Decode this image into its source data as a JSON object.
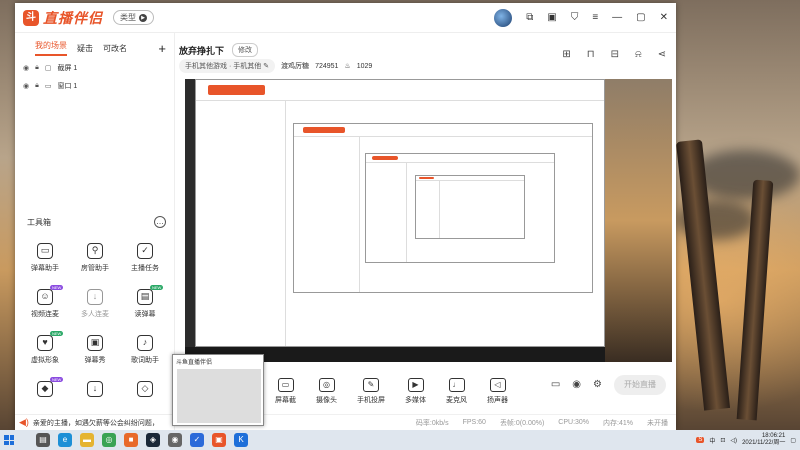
{
  "app": {
    "logo_text": "直播伴侣",
    "type_button": "类型",
    "brand_color": "#e8552a"
  },
  "titlebar_icons": [
    "avatar",
    "share-screen-icon",
    "save-icon",
    "shirt-icon",
    "menu-icon",
    "minimize-icon",
    "maximize-icon",
    "close-icon"
  ],
  "sidebar": {
    "tabs": [
      "我的场景",
      "疑击",
      "可改名"
    ],
    "add_label": "+",
    "sources": [
      {
        "label": "截屏 1"
      },
      {
        "label": "窗口 1"
      }
    ],
    "tools_title": "工具箱",
    "tools_more": "…",
    "tools": [
      {
        "label": "弹幕助手",
        "icon": "▭",
        "badge": ""
      },
      {
        "label": "房管助手",
        "icon": "⚲",
        "badge": ""
      },
      {
        "label": "主播任务",
        "icon": "✓",
        "badge": ""
      },
      {
        "label": "视频连麦",
        "icon": "☺",
        "badge": "NEW"
      },
      {
        "label": "多人连麦",
        "icon": "↓",
        "badge": ""
      },
      {
        "label": "读弹幕",
        "icon": "▤",
        "badge": "NEW"
      },
      {
        "label": "虚拟形象",
        "icon": "♥",
        "badge": "NEW"
      },
      {
        "label": "弹幕秀",
        "icon": "▣",
        "badge": ""
      },
      {
        "label": "歌词助手",
        "icon": "♪",
        "badge": ""
      },
      {
        "label": "",
        "icon": "◆",
        "badge": "NEW"
      },
      {
        "label": "",
        "icon": "↓",
        "badge": ""
      },
      {
        "label": "",
        "icon": "◇",
        "badge": ""
      }
    ],
    "notice": "亲爱的主播，如遇欠薪等公会纠纷问题，"
  },
  "main": {
    "title": "放弃挣扎下",
    "edit_label": "修改",
    "category": "手机其他游戏 · 手机其他",
    "room_label": "渡鸡厉糖",
    "room_id": "724951",
    "fans": "1029",
    "actions": [
      "tools-icon",
      "unlock-icon",
      "box-icon",
      "bell-icon",
      "share-icon"
    ]
  },
  "bottom_tools": [
    {
      "label": "屏幕截",
      "icon": "▭"
    },
    {
      "label": "摄像头",
      "icon": "◎"
    },
    {
      "label": "手机投屏",
      "icon": "✎"
    },
    {
      "label": "多媒体",
      "icon": "▶"
    },
    {
      "label": "麦克风",
      "icon": "♩"
    },
    {
      "label": "扬声器",
      "icon": "◁"
    }
  ],
  "live_button": "开始直播",
  "status": {
    "bitrate": "码率:0kb/s",
    "fps": "FPS:60",
    "drop": "丢帧:0(0.00%)",
    "cpu": "CPU:30%",
    "mem": "内存:41%",
    "network": "未开播"
  },
  "popup": {
    "title": "斗鱼直播伴侣"
  },
  "taskbar": {
    "apps": [
      {
        "name": "task-view",
        "color": "#555",
        "glyph": "▤"
      },
      {
        "name": "edge",
        "color": "#1d8fd6",
        "glyph": "e"
      },
      {
        "name": "explorer",
        "color": "#e5b431",
        "glyph": "▬"
      },
      {
        "name": "green-app",
        "color": "#3aa354",
        "glyph": "◎"
      },
      {
        "name": "orange-app",
        "color": "#e86a2a",
        "glyph": "■"
      },
      {
        "name": "steam",
        "color": "#1b2838",
        "glyph": "◈"
      },
      {
        "name": "app-grey",
        "color": "#666",
        "glyph": "◉"
      },
      {
        "name": "check-app",
        "color": "#2b6ad9",
        "glyph": "✓"
      },
      {
        "name": "douyu",
        "color": "#e8552a",
        "glyph": "▣"
      },
      {
        "name": "blue-app",
        "color": "#1e6fd9",
        "glyph": "K"
      }
    ],
    "ime": "中",
    "time": "18:06:21",
    "date": "2021/11/22/周一"
  }
}
